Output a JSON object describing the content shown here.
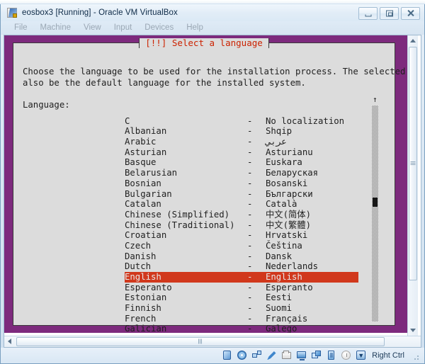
{
  "window": {
    "title": "eosbox3 [Running] - Oracle VM VirtualBox",
    "app_icon": "virtualbox-icon",
    "controls": {
      "minimize": "Minimize",
      "maximize": "Maximize",
      "close": "Close"
    }
  },
  "menubar": {
    "items": [
      {
        "label": "File"
      },
      {
        "label": "Machine"
      },
      {
        "label": "View"
      },
      {
        "label": "Input"
      },
      {
        "label": "Devices"
      },
      {
        "label": "Help"
      }
    ]
  },
  "installer": {
    "dialog_title": "[!!] Select a language",
    "description": "Choose the language to be used for the installation process. The selected\nalso be the default language for the installed system.",
    "language_label": "Language:",
    "separator": "-",
    "selected_language": "English",
    "colors": {
      "screen_background": "#7d2a7d",
      "dialog_background": "#dcdcdc",
      "title_text": "#cc2200",
      "selection_background": "#d1381c",
      "selection_text": "#e8e8e8"
    },
    "languages": [
      {
        "name": "C",
        "native": "No localization"
      },
      {
        "name": "Albanian",
        "native": "Shqip"
      },
      {
        "name": "Arabic",
        "native": "عربي"
      },
      {
        "name": "Asturian",
        "native": "Asturianu"
      },
      {
        "name": "Basque",
        "native": "Euskara"
      },
      {
        "name": "Belarusian",
        "native": "Беларуская"
      },
      {
        "name": "Bosnian",
        "native": "Bosanski"
      },
      {
        "name": "Bulgarian",
        "native": "Български"
      },
      {
        "name": "Catalan",
        "native": "Català"
      },
      {
        "name": "Chinese (Simplified)",
        "native": "中文(简体)"
      },
      {
        "name": "Chinese (Traditional)",
        "native": "中文(繁體)"
      },
      {
        "name": "Croatian",
        "native": "Hrvatski"
      },
      {
        "name": "Czech",
        "native": "Čeština"
      },
      {
        "name": "Danish",
        "native": "Dansk"
      },
      {
        "name": "Dutch",
        "native": "Nederlands"
      },
      {
        "name": "English",
        "native": "English"
      },
      {
        "name": "Esperanto",
        "native": "Esperanto"
      },
      {
        "name": "Estonian",
        "native": "Eesti"
      },
      {
        "name": "Finnish",
        "native": "Suomi"
      },
      {
        "name": "French",
        "native": "Français"
      },
      {
        "name": "Galician",
        "native": "Galego"
      }
    ],
    "scroll_up_arrow": "↑"
  },
  "statusbar": {
    "icons": [
      {
        "name": "hard-disk-icon"
      },
      {
        "name": "optical-disk-icon"
      },
      {
        "name": "network-icon"
      },
      {
        "name": "usb-pen-icon"
      },
      {
        "name": "shared-folders-icon"
      },
      {
        "name": "display-icon"
      },
      {
        "name": "vrde-window-icon"
      },
      {
        "name": "usb-device-icon"
      },
      {
        "name": "clock-icon"
      }
    ],
    "host_key_label": "Right Ctrl",
    "host_key_icon": "host-key-icon"
  }
}
